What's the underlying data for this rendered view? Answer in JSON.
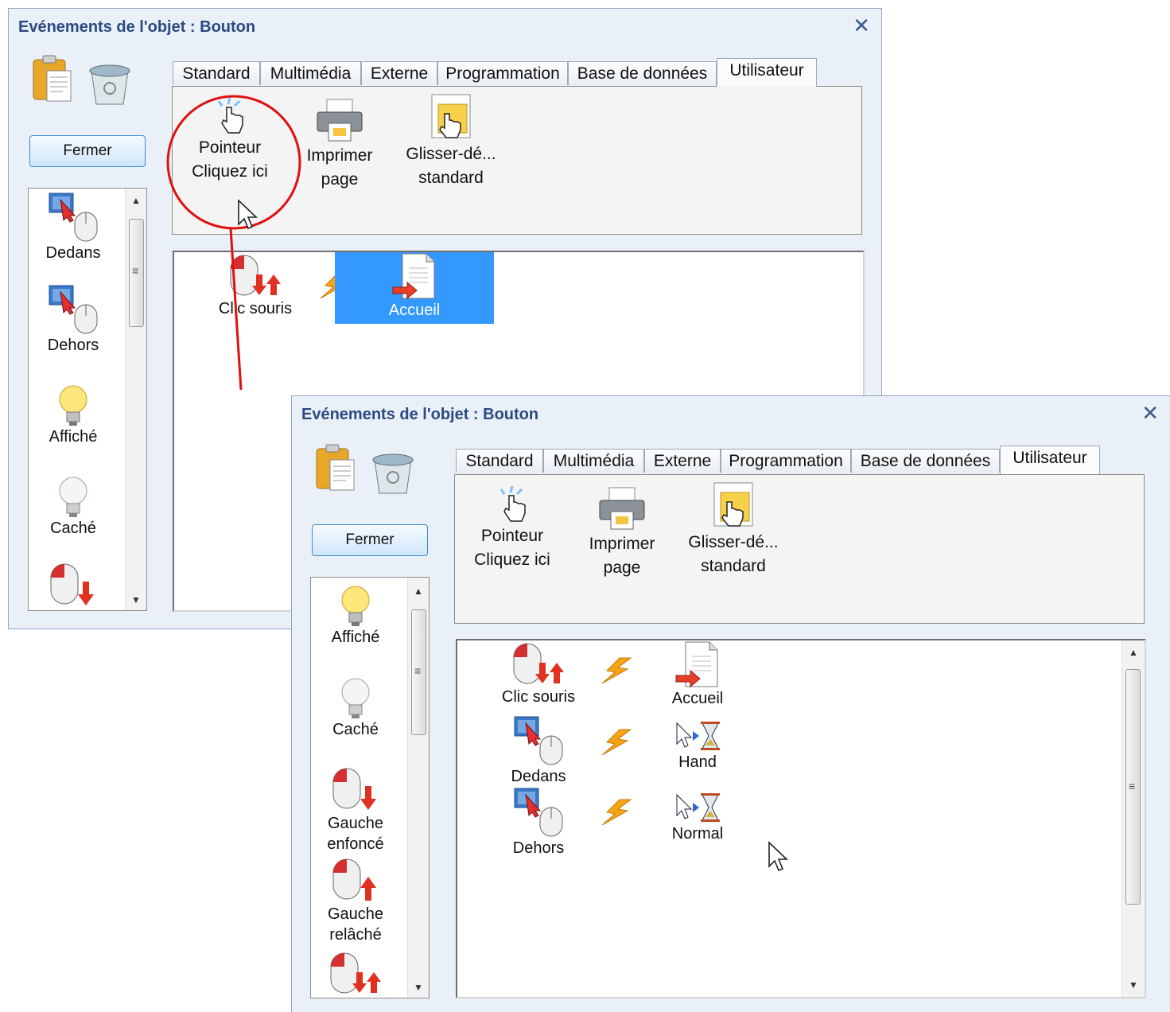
{
  "back_window": {
    "title": "Evénements de l'objet : Bouton",
    "close_label": "✕",
    "close_button_label": "Fermer",
    "tabs": [
      "Standard",
      "Multimédia",
      "Externe",
      "Programmation",
      "Base de données",
      "Utilisateur"
    ],
    "active_tab": "Utilisateur",
    "tab_items": [
      {
        "line1": "Pointeur",
        "line2": "Cliquez ici"
      },
      {
        "line1": "Imprimer",
        "line2": "page"
      },
      {
        "line1": "Glisser-dé...",
        "line2": "standard"
      }
    ],
    "side_items": [
      "Dedans",
      "Dehors",
      "Affiché",
      "Caché"
    ],
    "canvas": {
      "event": "Clic souris",
      "action": "Accueil"
    }
  },
  "front_window": {
    "title": "Evénements de l'objet : Bouton",
    "close_label": "✕",
    "close_button_label": "Fermer",
    "tabs": [
      "Standard",
      "Multimédia",
      "Externe",
      "Programmation",
      "Base de données",
      "Utilisateur"
    ],
    "active_tab": "Utilisateur",
    "tab_items": [
      {
        "line1": "Pointeur",
        "line2": "Cliquez ici"
      },
      {
        "line1": "Imprimer",
        "line2": "page"
      },
      {
        "line1": "Glisser-dé...",
        "line2": "standard"
      }
    ],
    "side_items": [
      {
        "line1": "Affiché",
        "line2": ""
      },
      {
        "line1": "Caché",
        "line2": ""
      },
      {
        "line1": "Gauche",
        "line2": "enfoncé"
      },
      {
        "line1": "Gauche",
        "line2": "relâché"
      }
    ],
    "rows": [
      {
        "event": "Clic souris",
        "action": "Accueil"
      },
      {
        "event": "Dedans",
        "action": "Hand"
      },
      {
        "event": "Dehors",
        "action": "Normal"
      }
    ]
  },
  "colors": {
    "title": "#2a4a82",
    "highlight_circle": "#e01010",
    "selection": "#3399ff"
  }
}
